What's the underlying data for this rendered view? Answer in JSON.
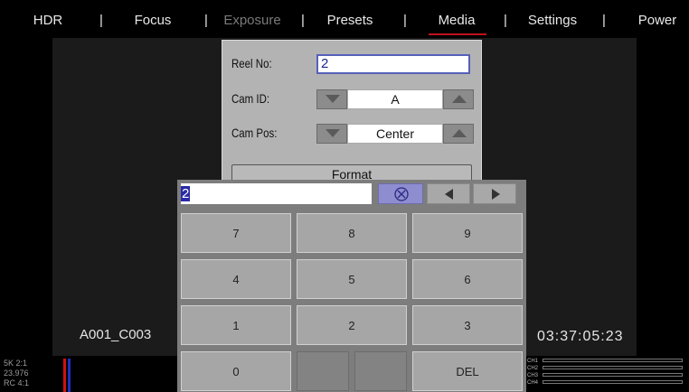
{
  "menu": {
    "tabs": [
      {
        "label": "HDR",
        "active": false,
        "enabled": true
      },
      {
        "label": "Focus",
        "active": false,
        "enabled": true
      },
      {
        "label": "Exposure",
        "active": false,
        "enabled": false
      },
      {
        "label": "Presets",
        "active": false,
        "enabled": true
      },
      {
        "label": "Media",
        "active": true,
        "enabled": true
      },
      {
        "label": "Settings",
        "active": false,
        "enabled": true
      },
      {
        "label": "Power",
        "active": false,
        "enabled": true
      }
    ],
    "separator": "|",
    "accent_color": "#c0101a"
  },
  "media_panel": {
    "reel_label": "Reel No:",
    "reel_value": "2",
    "cam_id_label": "Cam ID:",
    "cam_id_value": "A",
    "cam_pos_label": "Cam Pos:",
    "cam_pos_value": "Center",
    "format_label": "Format"
  },
  "keypad": {
    "entry_value": "2",
    "clear_icon": "circle-x-icon",
    "left_icon": "arrow-left-icon",
    "right_icon": "arrow-right-icon",
    "keys": {
      "k7": "7",
      "k8": "8",
      "k9": "9",
      "k4": "4",
      "k5": "5",
      "k6": "6",
      "k1": "1",
      "k2": "2",
      "k3": "3",
      "k0": "0",
      "del": "DEL"
    }
  },
  "status": {
    "clip_name": "A001_C003",
    "timecode": "03:37:05:23",
    "format_lines": [
      "5K 2:1",
      "23.976",
      "RC 4:1"
    ],
    "audio_channels": [
      "CH1",
      "CH2",
      "CH3",
      "CH4"
    ]
  }
}
